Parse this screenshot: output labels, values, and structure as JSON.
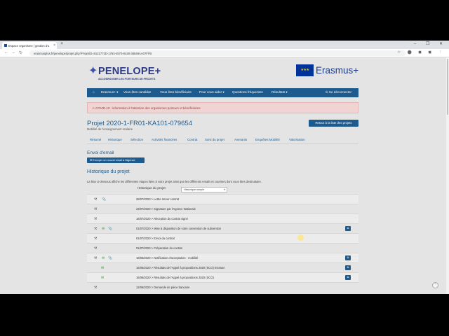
{
  "browser": {
    "tab_title": "Espace organisme | gestion d'u",
    "close": "×",
    "new_tab": "+",
    "window_controls": "– ❐ ✕",
    "url": "erasmusplus.fr/penelope/projet.php?ProjetID=9121772D-1763-4570-8428-38848AA07FFB",
    "back": "←",
    "forward": "→",
    "reload": "↻",
    "extensions": "☆ ⬤ ◼ ◼ ⋮"
  },
  "header": {
    "logo_name": "PENELOPE+",
    "logo_tagline": "ACCOMPAGNER LES PORTEURS DE PROJETS",
    "eu_stars": "★★★",
    "eu_name": "Erasmus+"
  },
  "nav": {
    "home_icon": "⌂",
    "items": [
      "Erasmus+ ▾",
      "Vous êtes candidat",
      "Vous êtes bénéficiaire",
      "Pour vous aider ▾",
      "Questions fréquentes",
      "Résultats ▾",
      "⏻ Se déconnecter"
    ]
  },
  "alert": "⚠ COVID-19 : information à l'attention des organismes porteurs et bénéficiaires",
  "project": {
    "title": "Projet 2020-1-FR01-KA101-079654",
    "subtitle": "Mobilité de l'enseignement scolaire",
    "back_button": "Retour à la liste des projets",
    "tabs": [
      "Résumé",
      "Historique",
      "Sélection",
      "Activités financées",
      "Contrat",
      "Suivi du projet",
      "Avenants",
      "Enquêtes Mobilité",
      "Valorisation"
    ]
  },
  "email_section": {
    "title": "Envoi d'email",
    "button": "✉ Envoyer un nouvel email à l'Agence"
  },
  "history": {
    "title": "Historique du projet",
    "description": "La liste ci-dessous affiche les différentes étapes liées à votre projet ainsi que les différents emails et courriers dont vous êtes destinataire.",
    "filter_label": "Historique du projet",
    "filter_value": "Historique simple",
    "filter_caret": "▾",
    "rows": [
      {
        "icons": [
          "⚒",
          "📎"
        ],
        "text": "28/07/2020 > Lettre retour contrat",
        "badge": ""
      },
      {
        "icons": [
          "⚒"
        ],
        "text": "23/07/2020 > Signature par l'Agence Nationale",
        "badge": ""
      },
      {
        "icons": [
          "⚒"
        ],
        "text": "16/07/2020 > Réception du contrat signé",
        "badge": ""
      },
      {
        "icons": [
          "⚒",
          "✉",
          "📎"
        ],
        "text": "01/07/2020 > Mise à disposition de votre convention de subvention",
        "badge": "⧉"
      },
      {
        "icons": [
          "⚒"
        ],
        "text": "01/07/2020 > Envoi du contrat",
        "badge": ""
      },
      {
        "icons": [
          "⚒"
        ],
        "text": "01/07/2020 > Préparation du contrat",
        "badge": ""
      },
      {
        "icons": [
          "⚒",
          "✉",
          "📎"
        ],
        "text": "19/06/2020 > Notification d'acceptation - mobilité",
        "badge": "⧉"
      },
      {
        "icons": [
          "✉"
        ],
        "text": "16/06/2020 > Résultats de l'Appel à propositions 2020 (SCO) Erratum",
        "badge": "⧉"
      },
      {
        "icons": [
          "✉"
        ],
        "text": "16/06/2020 > Résultats de l'Appel à propositions 2020 (SCO)",
        "badge": "⧉"
      },
      {
        "icons": [
          "⚒"
        ],
        "text": "12/06/2020 > Demande de pièce bancaire",
        "badge": ""
      }
    ]
  },
  "to_top": "⌃"
}
